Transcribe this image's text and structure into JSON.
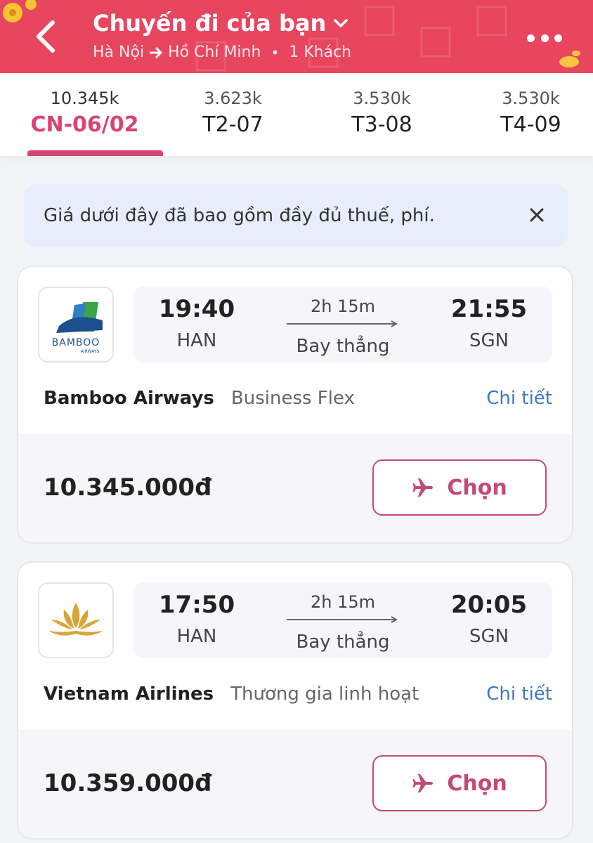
{
  "header": {
    "title": "Chuyến đi của bạn",
    "from": "Hà Nội",
    "to": "Hồ Chí Minh",
    "passengers": "1 Khách"
  },
  "date_tabs": [
    {
      "price": "10.345k",
      "date": "CN-06/02",
      "active": true
    },
    {
      "price": "3.623k",
      "date": "T2-07",
      "active": false
    },
    {
      "price": "3.530k",
      "date": "T3-08",
      "active": false
    },
    {
      "price": "3.530k",
      "date": "T4-09",
      "active": false
    }
  ],
  "notice": {
    "text": "Giá dưới đây đã bao gồm đầy đủ thuế, phí."
  },
  "flights": [
    {
      "airline": "Bamboo Airways",
      "logo_text": "BAMBOO",
      "logo_subtext": "AIRWAYS",
      "fare_class": "Business Flex",
      "dep_time": "19:40",
      "dep_code": "HAN",
      "arr_time": "21:55",
      "arr_code": "SGN",
      "duration": "2h 15m",
      "stops": "Bay thẳng",
      "detail_label": "Chi tiết",
      "price": "10.345.000đ",
      "choose_label": "Chọn"
    },
    {
      "airline": "Vietnam Airlines",
      "fare_class": "Thương gia linh hoạt",
      "dep_time": "17:50",
      "dep_code": "HAN",
      "arr_time": "20:05",
      "arr_code": "SGN",
      "duration": "2h 15m",
      "stops": "Bay thẳng",
      "detail_label": "Chi tiết",
      "price": "10.359.000đ",
      "choose_label": "Chọn"
    }
  ],
  "colors": {
    "header_bg": "#e8455f",
    "accent": "#d94473",
    "link": "#3b78c6",
    "notice_bg": "#e8edfb"
  }
}
